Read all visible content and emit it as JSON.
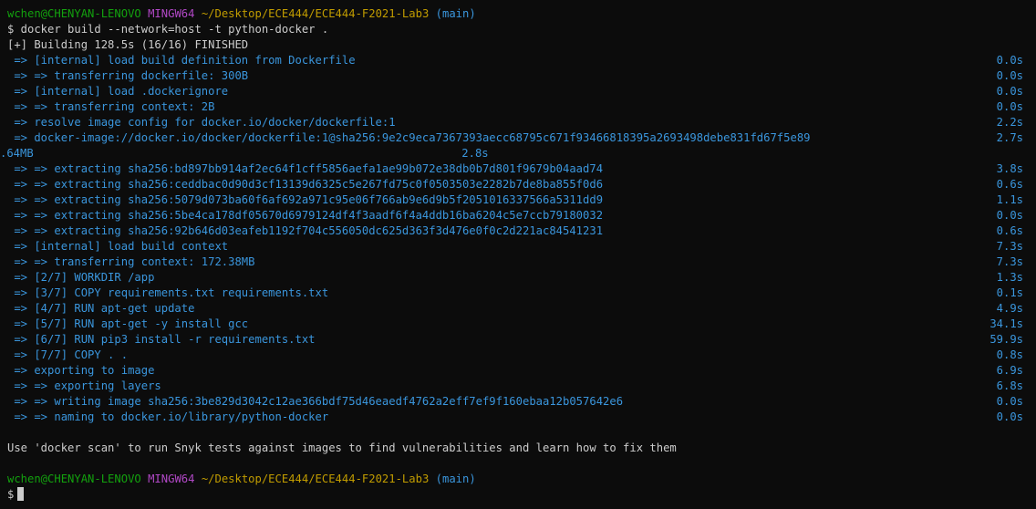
{
  "colors": {
    "background": "#0c0c0c",
    "text": "#cccccc",
    "user": "#13a10e",
    "host": "#b148c6",
    "path": "#c19c00",
    "branch": "#3a96dd",
    "build_step": "#3a96dd"
  },
  "prompt1": {
    "user": "wchen@CHENYAN-LENOVO",
    "env": "MINGW64",
    "path": "~/Desktop/ECE444/ECE444-F2021-Lab3",
    "branch": "(main)"
  },
  "command": "$ docker build --network=host -t python-docker .",
  "status": "[+] Building 128.5s (16/16) FINISHED",
  "steps": [
    {
      "text": " => [internal] load build definition from Dockerfile",
      "time": "0.0s"
    },
    {
      "text": " => => transferring dockerfile: 300B",
      "time": "0.0s"
    },
    {
      "text": " => [internal] load .dockerignore",
      "time": "0.0s"
    },
    {
      "text": " => => transferring context: 2B",
      "time": "0.0s"
    },
    {
      "text": " => resolve image config for docker.io/docker/dockerfile:1",
      "time": "2.2s"
    },
    {
      "text": " => docker-image://docker.io/docker/dockerfile:1@sha256:9e2c9eca7367393aecc68795c671f93466818395a2693498debe831fd67f5e89",
      "time": "2.7s"
    },
    {
      "text": ".64MB                                                                2.8s",
      "time": ""
    },
    {
      "text": " => => extracting sha256:bd897bb914af2ec64f1cff5856aefa1ae99b072e38db0b7d801f9679b04aad74",
      "time": "3.8s"
    },
    {
      "text": " => => extracting sha256:ceddbac0d90d3cf13139d6325c5e267fd75c0f0503503e2282b7de8ba855f0d6",
      "time": "0.6s"
    },
    {
      "text": " => => extracting sha256:5079d073ba60f6af692a971c95e06f766ab9e6d9b5f2051016337566a5311dd9",
      "time": "1.1s"
    },
    {
      "text": " => => extracting sha256:5be4ca178df05670d6979124df4f3aadf6f4a4ddb16ba6204c5e7ccb79180032",
      "time": "0.0s"
    },
    {
      "text": " => => extracting sha256:92b646d03eafeb1192f704c556050dc625d363f3d476e0f0c2d221ac84541231",
      "time": "0.6s"
    },
    {
      "text": " => [internal] load build context",
      "time": "7.3s"
    },
    {
      "text": " => => transferring context: 172.38MB",
      "time": "7.3s"
    },
    {
      "text": " => [2/7] WORKDIR /app",
      "time": "1.3s"
    },
    {
      "text": " => [3/7] COPY requirements.txt requirements.txt",
      "time": "0.1s"
    },
    {
      "text": " => [4/7] RUN apt-get update",
      "time": "4.9s"
    },
    {
      "text": " => [5/7] RUN apt-get -y install gcc",
      "time": "34.1s"
    },
    {
      "text": " => [6/7] RUN pip3 install -r requirements.txt",
      "time": "59.9s"
    },
    {
      "text": " => [7/7] COPY . .",
      "time": "0.8s"
    },
    {
      "text": " => exporting to image",
      "time": "6.9s"
    },
    {
      "text": " => => exporting layers",
      "time": "6.8s"
    },
    {
      "text": " => => writing image sha256:3be829d3042c12ae366bdf75d46eaedf4762a2eff7ef9f160ebaa12b057642e6",
      "time": "0.0s"
    },
    {
      "text": " => => naming to docker.io/library/python-docker",
      "time": "0.0s"
    }
  ],
  "scan_message": "Use 'docker scan' to run Snyk tests against images to find vulnerabilities and learn how to fix them",
  "prompt2": {
    "user": "wchen@CHENYAN-LENOVO",
    "env": "MINGW64",
    "path": "~/Desktop/ECE444/ECE444-F2021-Lab3",
    "branch": "(main)"
  },
  "final_prompt": "$"
}
